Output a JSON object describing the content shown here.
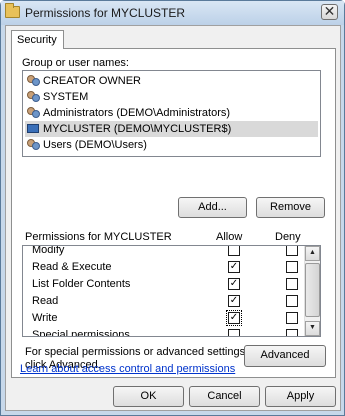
{
  "window": {
    "title": "Permissions for MYCLUSTER",
    "close_glyph": "✕"
  },
  "tabs": [
    {
      "label": "Security"
    }
  ],
  "group_label": "Group or user names:",
  "users": [
    {
      "name": "CREATOR OWNER",
      "icon": "users-icon"
    },
    {
      "name": "SYSTEM",
      "icon": "users-icon"
    },
    {
      "name": "Administrators (DEMO\\Administrators)",
      "icon": "users-icon"
    },
    {
      "name": "MYCLUSTER (DEMO\\MYCLUSTER$)",
      "icon": "computer-icon",
      "selected": true
    },
    {
      "name": "Users (DEMO\\Users)",
      "icon": "users-icon"
    }
  ],
  "buttons": {
    "add": "Add...",
    "remove": "Remove",
    "advanced": "Advanced",
    "ok": "OK",
    "cancel": "Cancel",
    "apply": "Apply"
  },
  "permissions": {
    "header": "Permissions for MYCLUSTER",
    "allow_header": "Allow",
    "deny_header": "Deny",
    "check_glyph": "✓",
    "rows": [
      {
        "name": "Modify",
        "allow": false,
        "deny": false
      },
      {
        "name": "Read & Execute",
        "allow": true,
        "deny": false
      },
      {
        "name": "List Folder Contents",
        "allow": true,
        "deny": false
      },
      {
        "name": "Read",
        "allow": true,
        "deny": false
      },
      {
        "name": "Write",
        "allow": true,
        "deny": false
      },
      {
        "name": "Special permissions",
        "allow": false,
        "deny": false
      }
    ]
  },
  "special_text": {
    "line1": "For special permissions or advanced settings,",
    "line2": "click Advanced."
  },
  "learn_link": "Learn about access control and permissions",
  "scroll": {
    "up": "▲",
    "down": "▼"
  }
}
